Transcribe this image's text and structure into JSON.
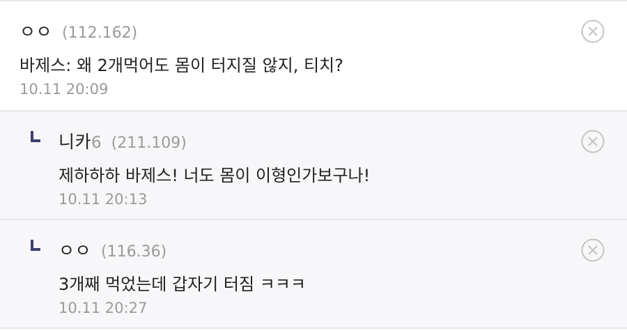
{
  "comments": [
    {
      "nickname": "ㅇㅇ",
      "nickname_suffix": "",
      "ip": "(112.162)",
      "text": "바제스: 왜 2개먹어도 몸이 터지질 않지, 티치?",
      "date": "10.11 20:09",
      "is_reply": false
    },
    {
      "nickname": "니카",
      "nickname_suffix": "6",
      "ip": "(211.109)",
      "text": "제하하하 바제스! 너도 몸이 이형인가보구나!",
      "date": "10.11 20:13",
      "is_reply": true
    },
    {
      "nickname": "ㅇㅇ",
      "nickname_suffix": "",
      "ip": "(116.36)",
      "text": "3개째 먹었는데 갑자기 터짐 ㅋㅋㅋ",
      "date": "10.11 20:27",
      "is_reply": true
    }
  ],
  "icons": {
    "reply": "reply-arrow-icon",
    "delete": "close-circle-icon"
  },
  "colors": {
    "reply_icon": "#3d3f6e",
    "meta_text": "#9a9a9a",
    "reply_background": "#f7f7f9",
    "divider": "#e6e6ea"
  }
}
